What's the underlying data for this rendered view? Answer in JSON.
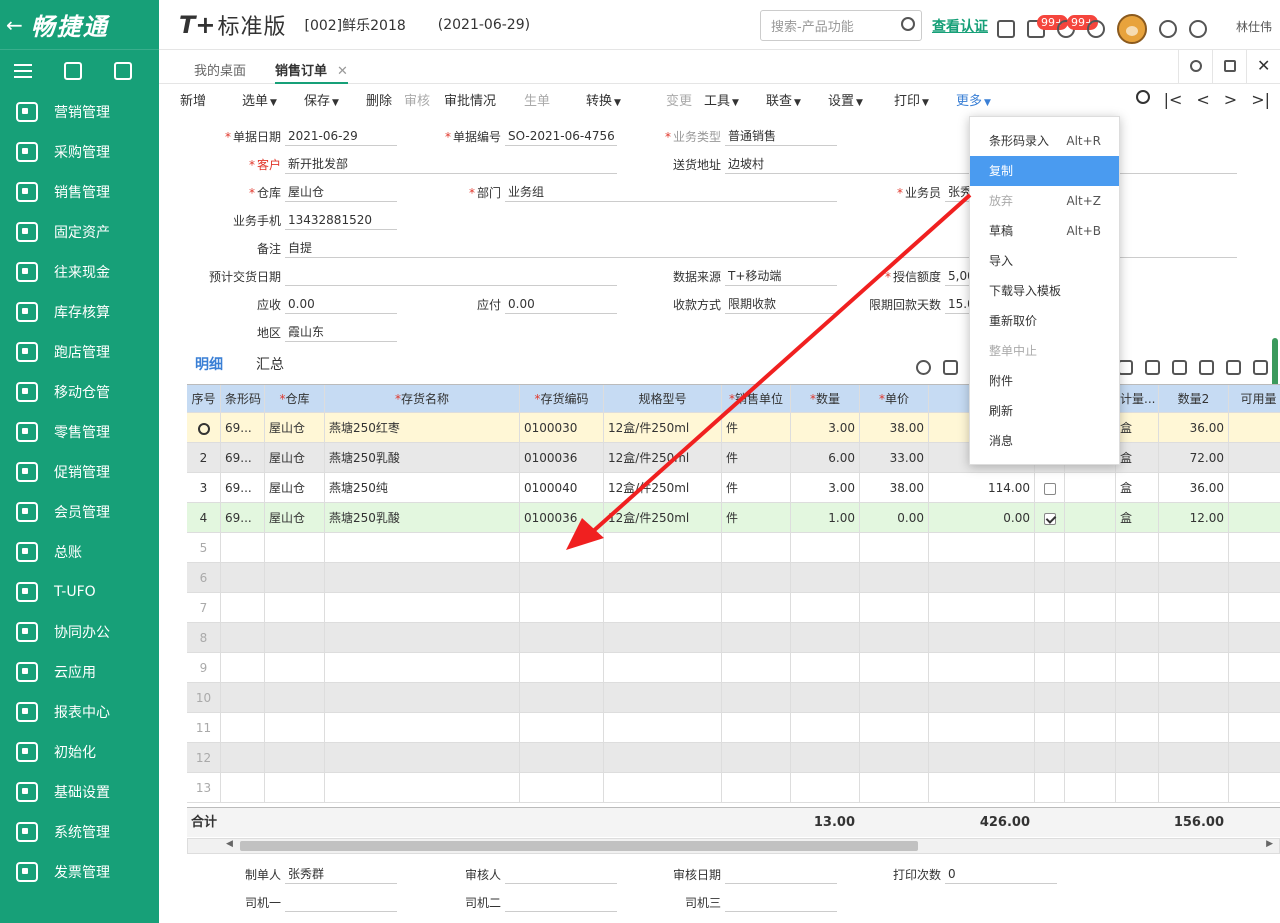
{
  "brand": {
    "name": "畅捷通",
    "back": "←"
  },
  "sidebar": {
    "items": [
      {
        "label": "营销管理"
      },
      {
        "label": "采购管理"
      },
      {
        "label": "销售管理"
      },
      {
        "label": "固定资产"
      },
      {
        "label": "往来现金"
      },
      {
        "label": "库存核算"
      },
      {
        "label": "跑店管理"
      },
      {
        "label": "移动仓管"
      },
      {
        "label": "零售管理"
      },
      {
        "label": "促销管理"
      },
      {
        "label": "会员管理"
      },
      {
        "label": "总账"
      },
      {
        "label": "T-UFO"
      },
      {
        "label": "协同办公"
      },
      {
        "label": "云应用"
      },
      {
        "label": "报表中心"
      },
      {
        "label": "初始化"
      },
      {
        "label": "基础设置"
      },
      {
        "label": "系统管理"
      },
      {
        "label": "发票管理"
      }
    ]
  },
  "header": {
    "logo_mark": "T+",
    "logo_text": "标准版",
    "account": "[002]鲜乐2018",
    "date": "(2021-06-29)",
    "search_placeholder": "搜索-产品功能",
    "verify": "查看认证",
    "badge1": "99+",
    "badge2": "99+",
    "user": "林仕伟"
  },
  "tabs": [
    {
      "label": "我的桌面"
    },
    {
      "label": "销售订单",
      "close": "✕"
    }
  ],
  "toolbar": {
    "items": [
      "新增",
      "选单",
      "保存",
      "删除",
      "审核",
      "审批情况",
      "生单",
      "转换",
      "变更",
      "工具",
      "联查",
      "设置",
      "打印",
      "更多"
    ],
    "arrows": [
      "|<",
      "<",
      ">",
      ">|"
    ]
  },
  "form": {
    "date_label": "单据日期",
    "date": "2021-06-29",
    "no_label": "单据编号",
    "no": "SO-2021-06-4756",
    "type_label": "业务类型",
    "type": "普通销售",
    "customer_label": "客户",
    "customer": "新开批发部",
    "address_label": "送货地址",
    "address": "边坡村",
    "warehouse_label": "仓库",
    "warehouse": "屋山仓",
    "dept_label": "部门",
    "dept": "业务组",
    "salesman_label": "业务员",
    "salesman": "张秀",
    "phone_label": "业务手机",
    "phone": "13432881520",
    "note_label": "备注",
    "note": "自提",
    "delivery_label": "预计交货日期",
    "delivery": "",
    "source_label": "数据来源",
    "source": "T+移动端",
    "credit_label": "授信额度",
    "credit": "5,00",
    "receivable_label": "应收",
    "receivable": "0.00",
    "payable_label": "应付",
    "payable": "0.00",
    "paymethod_label": "收款方式",
    "paymethod": "限期收款",
    "days_label": "限期回款天数",
    "days": "15.0",
    "region_label": "地区",
    "region": "霞山东"
  },
  "subtabs": [
    "明细",
    "汇总"
  ],
  "grid": {
    "columns": [
      "序号",
      "条形码",
      "仓库",
      "存货名称",
      "存货编码",
      "规格型号",
      "销售单位",
      "数量",
      "单价",
      "",
      "",
      "",
      "计量...",
      "数量2",
      "可用量"
    ],
    "required": [
      false,
      false,
      true,
      true,
      true,
      false,
      true,
      true,
      true,
      false,
      false,
      false,
      false,
      false,
      false
    ],
    "rows": [
      {
        "no": "",
        "barcode": "69...",
        "wh": "屋山仓",
        "name": "燕塘250红枣",
        "code": "0100030",
        "spec": "12盒/件250ml",
        "unit": "件",
        "qty": "3.00",
        "price": "38.00",
        "amount": "",
        "unit2": "盒",
        "qty2": "36.00"
      },
      {
        "no": "2",
        "barcode": "69...",
        "wh": "屋山仓",
        "name": "燕塘250乳酸",
        "code": "0100036",
        "spec": "12盒/件250ml",
        "unit": "件",
        "qty": "6.00",
        "price": "33.00",
        "amount": "",
        "unit2": "盒",
        "qty2": "72.00"
      },
      {
        "no": "3",
        "barcode": "69...",
        "wh": "屋山仓",
        "name": "燕塘250纯",
        "code": "0100040",
        "spec": "12盒/件250ml",
        "unit": "件",
        "qty": "3.00",
        "price": "38.00",
        "amount": "114.00",
        "unit2": "盒",
        "qty2": "36.00"
      },
      {
        "no": "4",
        "barcode": "69...",
        "wh": "屋山仓",
        "name": "燕塘250乳酸",
        "code": "0100036",
        "spec": "12盒/件250ml",
        "unit": "件",
        "qty": "1.00",
        "price": "0.00",
        "amount": "0.00",
        "unit2": "盒",
        "qty2": "12.00"
      }
    ],
    "empty_rows": [
      "5",
      "6",
      "7",
      "8",
      "9",
      "10",
      "11",
      "12",
      "13"
    ]
  },
  "totals": {
    "label": "合计",
    "qty": "13.00",
    "amount": "426.00",
    "qty2": "156.00"
  },
  "footer": {
    "maker_label": "制单人",
    "maker": "张秀群",
    "auditor_label": "审核人",
    "audit_date_label": "审核日期",
    "print_label": "打印次数",
    "print": "0",
    "driver1": "司机一",
    "driver2": "司机二",
    "driver3": "司机三"
  },
  "more_menu": [
    {
      "label": "条形码录入",
      "shortcut": "Alt+R"
    },
    {
      "label": "复制",
      "shortcut": ""
    },
    {
      "label": "放弃",
      "shortcut": "Alt+Z"
    },
    {
      "label": "草稿",
      "shortcut": "Alt+B"
    },
    {
      "label": "导入",
      "shortcut": ""
    },
    {
      "label": "下载导入模板",
      "shortcut": ""
    },
    {
      "label": "重新取价",
      "shortcut": ""
    },
    {
      "label": "整单中止",
      "shortcut": ""
    },
    {
      "label": "附件",
      "shortcut": ""
    },
    {
      "label": "刷新",
      "shortcut": ""
    },
    {
      "label": "消息",
      "shortcut": ""
    }
  ],
  "colors": {
    "brand": "#17a078",
    "accent": "#3a7fd5",
    "header_row": "#c6dbf3",
    "selected_row": "#fff7d6",
    "alt_row": "#e8e8e8",
    "checked_row": "#e3f7df",
    "arrow": "#f02020",
    "menu_highlight": "#4a9bf0"
  }
}
